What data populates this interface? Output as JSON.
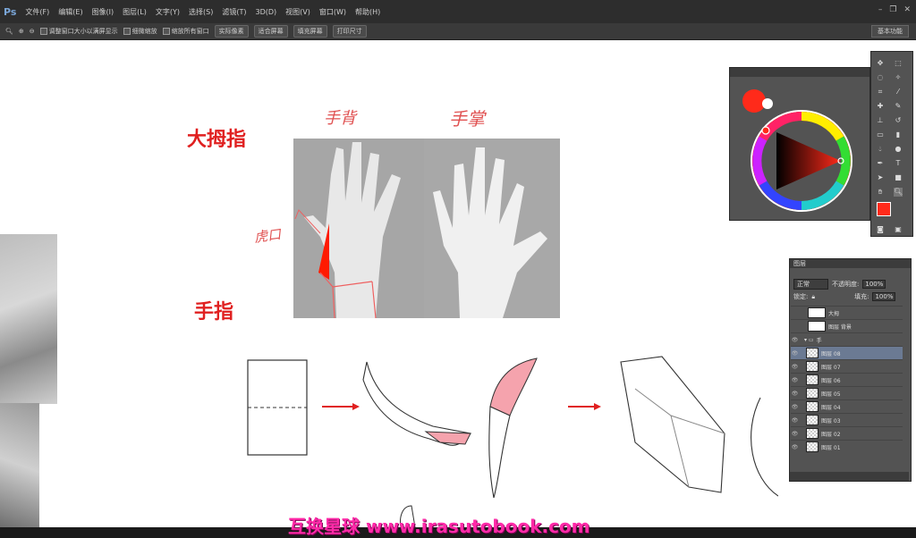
{
  "app": {
    "logo": "Ps"
  },
  "menu": {
    "items": [
      "文件(F)",
      "编辑(E)",
      "图像(I)",
      "图层(L)",
      "文字(Y)",
      "选择(S)",
      "滤镜(T)",
      "3D(D)",
      "视图(V)",
      "窗口(W)",
      "帮助(H)"
    ]
  },
  "optionsbar": {
    "zoom_label": "Q",
    "resize_label": "调整窗口大小以满屏显示",
    "scrubby_label": "细微缩放",
    "allwin_label": "缩放所有窗口",
    "actual_pixels": "实际像素",
    "fit_screen": "适合屏幕",
    "fill_screen": "填充屏幕",
    "print_size": "打印尺寸",
    "workspace": "基本功能"
  },
  "canvas": {
    "label_thumb": "大拇指",
    "label_fingers": "手指",
    "hw_back": "手背",
    "hw_palm": "手掌",
    "hw_web": "虎口"
  },
  "layers_panel": {
    "title": "图层",
    "blend_mode": "正常",
    "opacity_label": "不透明度:",
    "opacity_value": "100%",
    "lock_label": "锁定:",
    "fill_label": "填充:",
    "fill_value": "100%",
    "rows": [
      {
        "name": "大拇",
        "visible": false,
        "type": "layer"
      },
      {
        "name": "图层 背景",
        "visible": false,
        "type": "layer"
      },
      {
        "name": "手",
        "visible": true,
        "type": "group"
      },
      {
        "name": "图层 08",
        "visible": true,
        "type": "layer",
        "selected": true
      },
      {
        "name": "图层 07",
        "visible": true,
        "type": "layer"
      },
      {
        "name": "图层 06",
        "visible": true,
        "type": "layer"
      },
      {
        "name": "图层 05",
        "visible": true,
        "type": "layer"
      },
      {
        "name": "图层 04",
        "visible": true,
        "type": "layer"
      },
      {
        "name": "图层 03",
        "visible": true,
        "type": "layer"
      },
      {
        "name": "图层 02",
        "visible": true,
        "type": "layer"
      },
      {
        "name": "图层 01",
        "visible": true,
        "type": "layer"
      }
    ]
  },
  "colors": {
    "foreground": "#ff2a1a",
    "background": "#ffffff",
    "accent_red": "#e02020",
    "pink_fill": "#f5a3ad"
  },
  "watermark": "互换星球 www.irasutobook.com"
}
